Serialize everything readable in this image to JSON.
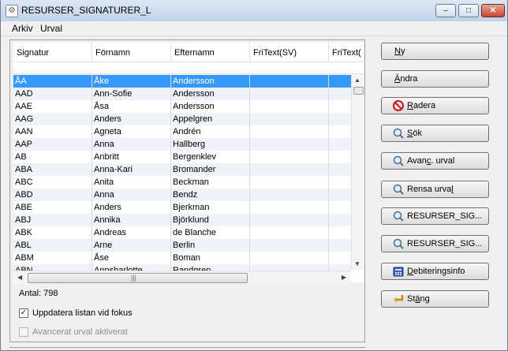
{
  "window": {
    "title": "RESURSER_SIGNATURER_L",
    "controls": {
      "minimize": "–",
      "maximize": "□",
      "close": "✕"
    }
  },
  "menu": [
    "Arkiv",
    "Urval"
  ],
  "grid": {
    "columns": [
      "Signatur",
      "Förnamn",
      "Efternamn",
      "FriText(SV)",
      "FriText("
    ],
    "rows": [
      [
        "ÅA",
        "Åke",
        "Andersson",
        "",
        ""
      ],
      [
        "AAD",
        "Ann-Sofie",
        "Andersson",
        "",
        ""
      ],
      [
        "AAE",
        "Åsa",
        "Andersson",
        "",
        ""
      ],
      [
        "AAG",
        "Anders",
        "Appelgren",
        "",
        ""
      ],
      [
        "AAN",
        "Agneta",
        "Andrén",
        "",
        ""
      ],
      [
        "AAP",
        "Anna",
        "Hallberg",
        "",
        ""
      ],
      [
        "AB",
        "Anbritt",
        "Bergenklev",
        "",
        ""
      ],
      [
        "ABA",
        "Anna-Kari",
        "Bromander",
        "",
        ""
      ],
      [
        "ABC",
        "Anita",
        "Beckman",
        "",
        ""
      ],
      [
        "ABD",
        "Anna",
        "Bendz",
        "",
        ""
      ],
      [
        "ABE",
        "Anders",
        "Bjerkman",
        "",
        ""
      ],
      [
        "ABJ",
        "Annika",
        "Björklund",
        "",
        ""
      ],
      [
        "ABK",
        "Andreas",
        "de Blanche",
        "",
        ""
      ],
      [
        "ABL",
        "Arne",
        "Berlin",
        "",
        ""
      ],
      [
        "ABM",
        "Åse",
        "Boman",
        "",
        ""
      ],
      [
        "ABN",
        "Annsharlotte",
        "Randgren",
        "",
        ""
      ]
    ]
  },
  "status": {
    "count_label": "Antal: 798"
  },
  "options": {
    "refresh_on_focus": {
      "label": "Uppdatera listan vid fokus",
      "checked": true
    },
    "advanced_filter": {
      "label": "Avancerat urval aktiverat",
      "checked": false,
      "disabled": true
    }
  },
  "buttons": {
    "ny": {
      "pre": "",
      "u": "N",
      "post": "y"
    },
    "andra": {
      "pre": "",
      "u": "Ä",
      "post": "ndra"
    },
    "radera": {
      "pre": "",
      "u": "R",
      "post": "adera"
    },
    "sok": {
      "pre": "",
      "u": "S",
      "post": "ök"
    },
    "avanc": {
      "pre": "Avan",
      "u": "c",
      "post": ". urval"
    },
    "rensa": {
      "pre": "Rensa urva",
      "u": "l",
      "post": ""
    },
    "resurser1": {
      "pre": "RESURSER_SIG...",
      "u": "",
      "post": ""
    },
    "resurser2": {
      "pre": "RESURSER_SIG...",
      "u": "",
      "post": ""
    },
    "debitering": {
      "pre": "",
      "u": "D",
      "post": "ebiteringsinfo"
    },
    "stang": {
      "pre": "St",
      "u": "ä",
      "post": "ng"
    }
  },
  "colors": {
    "selection": "#3399ff",
    "row_alt": "#eef3fa",
    "delete_icon": "#cc1111"
  }
}
